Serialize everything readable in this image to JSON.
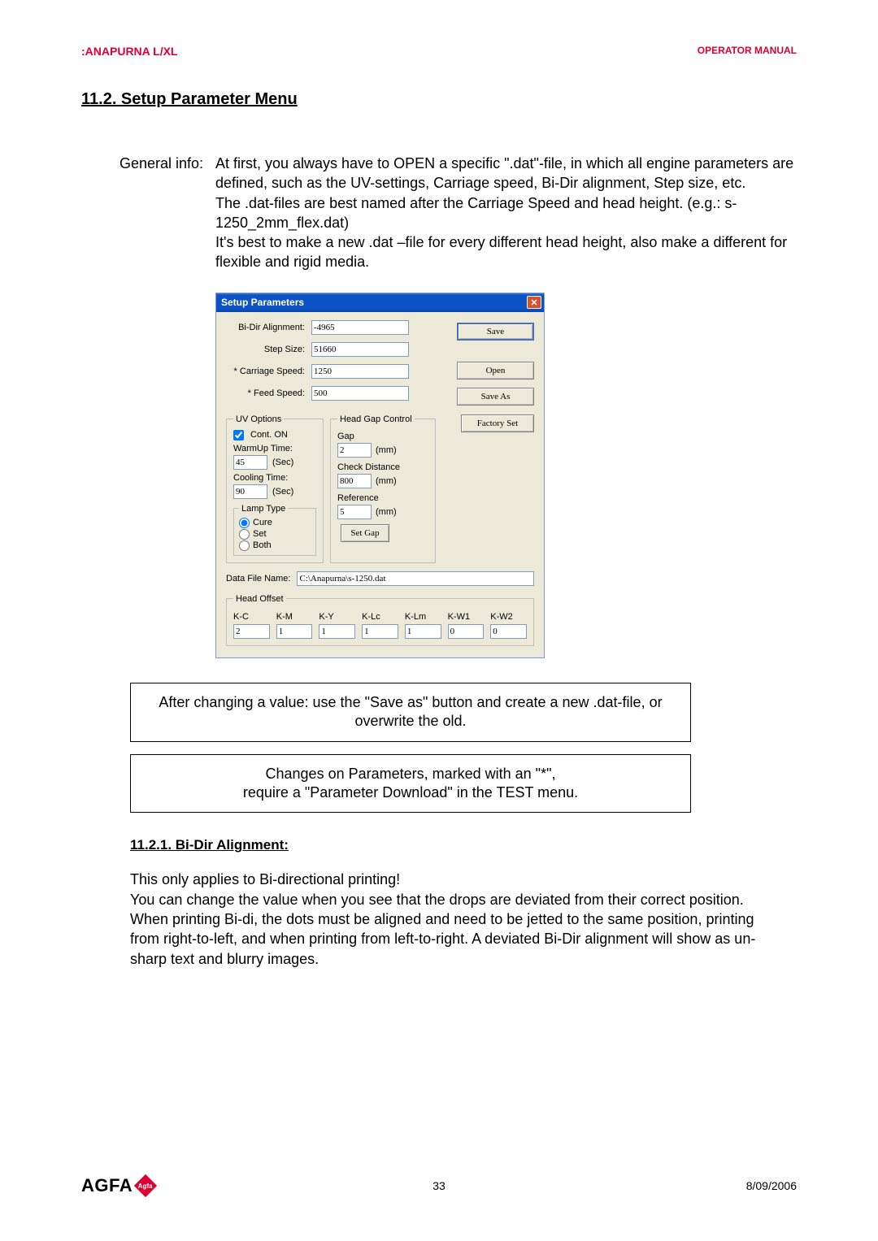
{
  "header": {
    "product": ":ANAPURNA L/XL",
    "doc_type": "OPERATOR MANUAL"
  },
  "section_title": "11.2. Setup Parameter Menu",
  "general_info": {
    "label": "General info:",
    "body": "At first, you always have to OPEN a specific \".dat\"-file, in which all engine parameters are defined, such as the UV-settings, Carriage speed, Bi-Dir alignment, Step size, etc.\nThe .dat-files are best named after the Carriage Speed and head height. (e.g.: s-1250_2mm_flex.dat)\nIt's best to make a new .dat –file for every different head height, also make a different for flexible and rigid media."
  },
  "dialog": {
    "title": "Setup Parameters",
    "params": {
      "bidir_label": "Bi-Dir Alignment:",
      "bidir_value": "-4965",
      "step_label": "Step Size:",
      "step_value": "51660",
      "carriage_label": "* Carriage Speed:",
      "carriage_value": "1250",
      "feed_label": "* Feed Speed:",
      "feed_value": "500"
    },
    "buttons": {
      "save": "Save",
      "open": "Open",
      "save_as": "Save As",
      "factory": "Factory Set"
    },
    "uv": {
      "legend": "UV Options",
      "cont_on": "Cont. ON",
      "warmup_label": "WarmUp Time:",
      "warmup_value": "45",
      "warmup_unit": "(Sec)",
      "cooling_label": "Cooling Time:",
      "cooling_value": "90",
      "cooling_unit": "(Sec)",
      "lamp_legend": "Lamp Type",
      "lamp_cure": "Cure",
      "lamp_set": "Set",
      "lamp_both": "Both"
    },
    "hgc": {
      "legend": "Head Gap Control",
      "gap_label": "Gap",
      "gap_value": "2",
      "gap_unit": "(mm)",
      "check_label": "Check Distance",
      "check_value": "800",
      "check_unit": "(mm)",
      "ref_label": "Reference",
      "ref_value": "5",
      "ref_unit": "(mm)",
      "set_gap": "Set Gap"
    },
    "dfn": {
      "label": "Data File Name:",
      "value": "C:\\Anapurna\\s-1250.dat"
    },
    "head_offset": {
      "legend": "Head Offset",
      "cols": [
        "K-C",
        "K-M",
        "K-Y",
        "K-Lc",
        "K-Lm",
        "K-W1",
        "K-W2"
      ],
      "vals": [
        "2",
        "1",
        "1",
        "1",
        "1",
        "0",
        "0"
      ]
    }
  },
  "notices": {
    "n1": "After changing a value: use the \"Save as\" button and create a new .dat-file, or overwrite the old.",
    "n2": "Changes on Parameters, marked with an \"*\",\nrequire a \"Parameter Download\" in the TEST menu."
  },
  "subsection": "11.2.1. Bi-Dir Alignment:",
  "body_text": "This only applies to Bi-directional printing!\nYou can change the value when you see that the drops are deviated from their correct position. When printing Bi-di, the dots must be aligned and need to be jetted to the same position, printing from right-to-left, and when printing from left-to-right. A deviated Bi-Dir alignment will show as un-sharp text and blurry images.",
  "footer": {
    "logo": "AGFA",
    "page": "33",
    "date": "8/09/2006"
  }
}
